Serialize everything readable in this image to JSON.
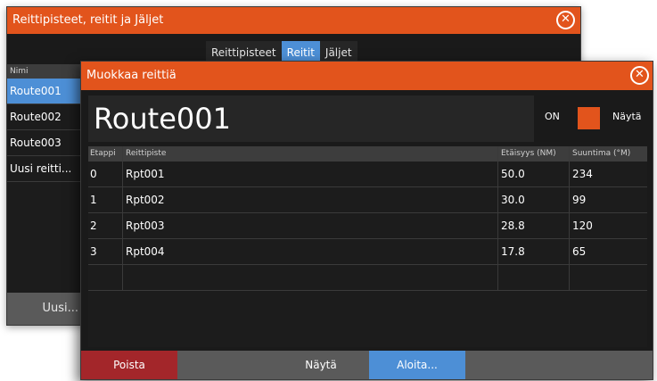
{
  "back_dialog": {
    "title": "Reittipisteet, reitit ja Jäljet",
    "tabs": [
      "Reittipisteet",
      "Reitit",
      "Jäljet"
    ],
    "active_tab": "Reitit",
    "list_header": "Nimi",
    "items": [
      "Route001",
      "Route002",
      "Route003",
      "Uusi reitti..."
    ],
    "new_button": "Uusi..."
  },
  "front_dialog": {
    "title": "Muokkaa reittiä",
    "route_name": "Route001",
    "on_label": "ON",
    "show_label": "Näytä",
    "table": {
      "headers": {
        "stage": "Etappi",
        "waypoint": "Reittipiste",
        "distance": "Etäisyys (NM)",
        "bearing": "Suuntima (°M)"
      },
      "rows": [
        {
          "stage": "0",
          "waypoint": "Rpt001",
          "distance": "50.0",
          "bearing": "234"
        },
        {
          "stage": "1",
          "waypoint": "Rpt002",
          "distance": "30.0",
          "bearing": "99"
        },
        {
          "stage": "2",
          "waypoint": "Rpt003",
          "distance": "28.8",
          "bearing": "120"
        },
        {
          "stage": "3",
          "waypoint": "Rpt004",
          "distance": "17.8",
          "bearing": "65"
        }
      ]
    },
    "buttons": {
      "delete": "Poista",
      "show": "Näytä",
      "start": "Aloita..."
    }
  },
  "colors": {
    "accent_orange": "#e2541c",
    "selected_blue": "#4d8fd6",
    "delete_red": "#a3262a"
  }
}
